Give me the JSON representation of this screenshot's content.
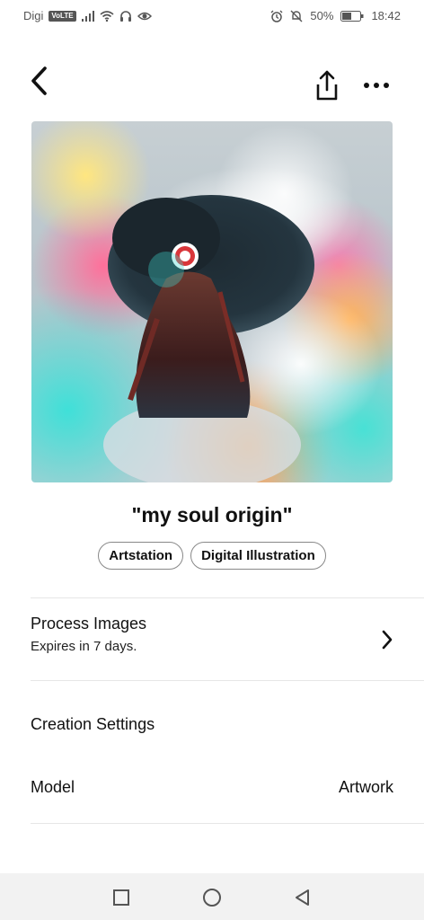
{
  "status_bar": {
    "carrier": "Digi",
    "volte": "VoLTE",
    "battery": "50%",
    "time": "18:42",
    "icons": [
      "signal-icon",
      "wifi-icon",
      "headphones-icon",
      "eye-icon",
      "alarm-icon",
      "mute-icon",
      "battery-icon"
    ]
  },
  "header": {
    "back_icon": "chevron-left-icon",
    "share_icon": "share-icon",
    "more_icon": "more-horizontal-icon"
  },
  "artwork": {
    "title": "\"my soul origin\"",
    "tags": [
      "Artstation",
      "Digital Illustration"
    ]
  },
  "process": {
    "label": "Process Images",
    "sub": "Expires in 7 days."
  },
  "settings": {
    "section_title": "Creation Settings",
    "model_label": "Model",
    "model_value": "Artwork"
  },
  "nav": {
    "icons": [
      "recent-apps-icon",
      "home-icon",
      "back-icon"
    ]
  },
  "colors": {
    "accent": "#111111",
    "divider": "#e6e6e6",
    "navbar": "#f2f2f2"
  }
}
